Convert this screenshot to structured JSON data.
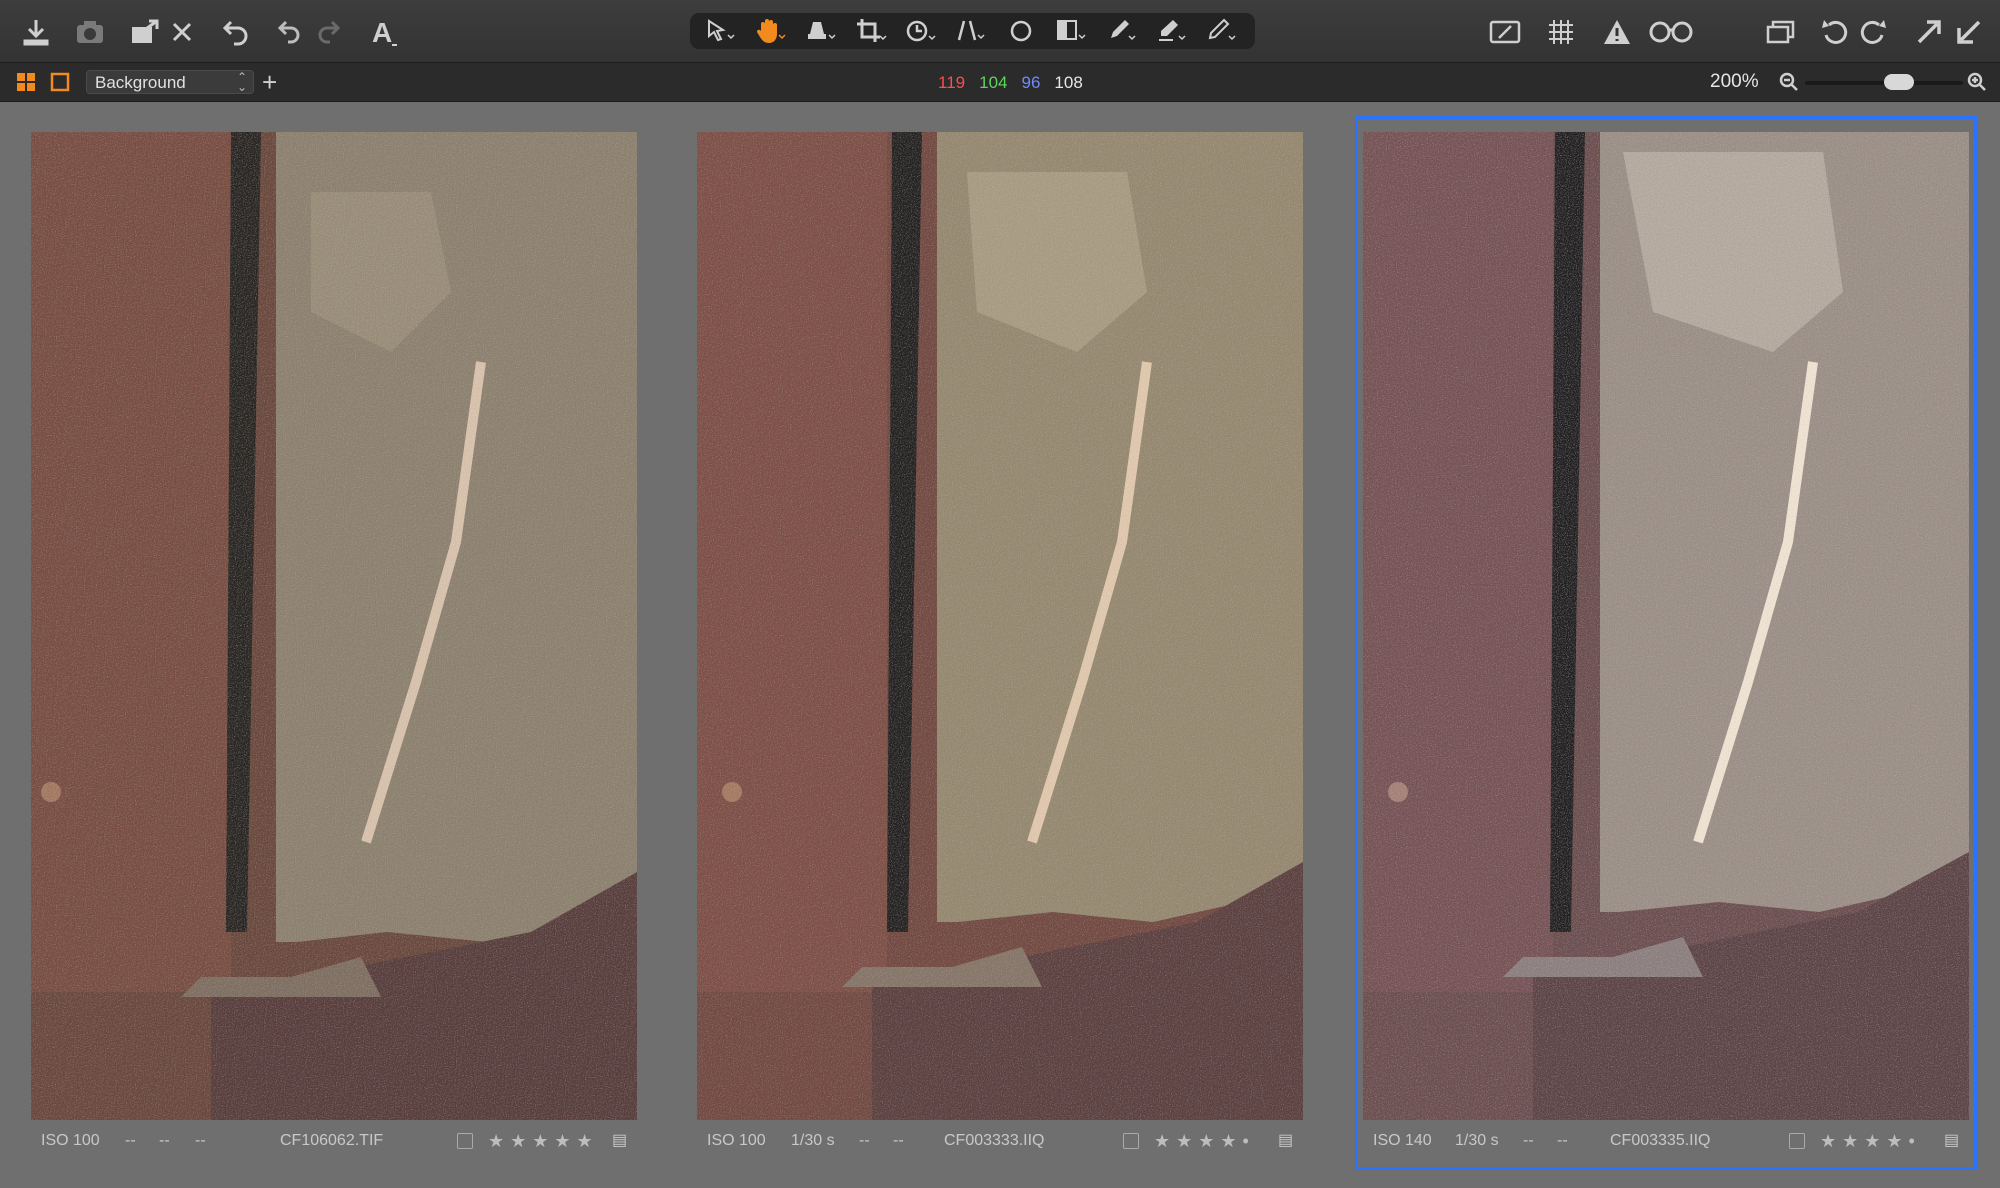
{
  "toolbar": {
    "left_tools": [
      "import-icon",
      "capture-camera-icon",
      "export-icon",
      "delete-icon",
      "undo-history-icon",
      "undo-icon",
      "redo-icon",
      "text-icon"
    ],
    "center_tools": [
      "select-cursor-icon",
      "hand-pan-icon",
      "stamp-icon",
      "crop-icon",
      "rotate-icon",
      "keystone-icon",
      "circle-mask-icon",
      "gradient-mask-icon",
      "brush-icon",
      "erase-icon",
      "picker-icon"
    ],
    "right_tools": [
      "annotate-icon",
      "grid-icon",
      "exposure-warning-icon",
      "proof-glasses-icon",
      "viewer-icon",
      "rotate-left-icon",
      "rotate-right-icon",
      "expand-icon",
      "collapse-icon"
    ],
    "active_tool_color": "#f28a1e"
  },
  "subbar": {
    "layer_name": "Background",
    "add_symbol": "+",
    "rgb": {
      "r": "119",
      "g": "104",
      "b": "96",
      "l": "108"
    },
    "rgb_colors": {
      "r": "#ff4c4c",
      "g": "#5ed35e",
      "b": "#6f8bff",
      "l": "#e6e6e6"
    },
    "zoom_text": "200%",
    "zoom_fraction": 0.62
  },
  "panels": [
    {
      "iso": "ISO 100",
      "shutter": "--",
      "f1": "--",
      "f2": "--",
      "filename": "CF106062.TIF",
      "rating_stars": "★★★★★",
      "selected": false
    },
    {
      "iso": "ISO 100",
      "shutter": "1/30 s",
      "f1": "--",
      "f2": "--",
      "filename": "CF003333.IIQ",
      "rating_stars": "★★★★•",
      "selected": false
    },
    {
      "iso": "ISO 140",
      "shutter": "1/30 s",
      "f1": "--",
      "f2": "--",
      "filename": "CF003335.IIQ",
      "rating_stars": "★★★★•",
      "selected": true
    }
  ],
  "colors": {
    "selection_outline": "#2a73ff",
    "background": "#6f6f6f"
  }
}
